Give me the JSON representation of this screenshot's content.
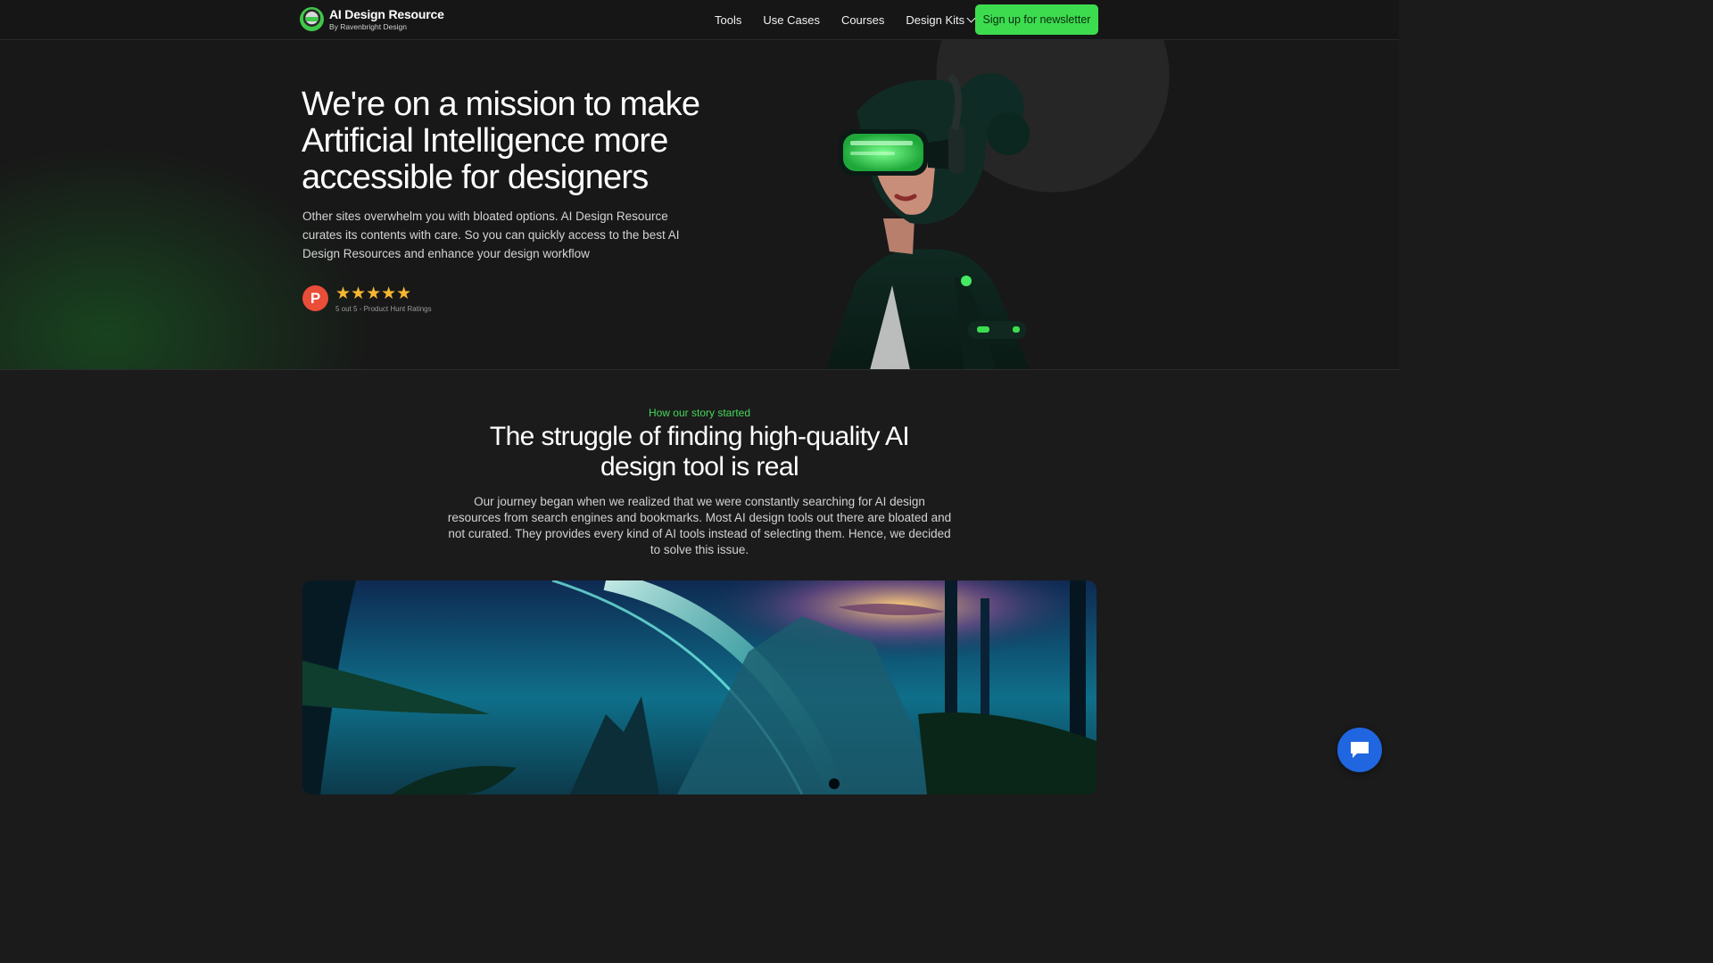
{
  "nav": {
    "logo_title": "AI Design Resource",
    "logo_sub": "By Ravenbright Design",
    "links": [
      "Tools",
      "Use Cases",
      "Courses",
      "Design Kits"
    ],
    "cta": "Sign up for newsletter"
  },
  "hero": {
    "title": "We're on a mission to make Artificial Intelligence more accessible for designers",
    "description": "Other sites overwhelm you with bloated options. AI Design Resource curates its contents with care. So you can quickly access to the best AI Design Resources and enhance your design workflow",
    "badge_letter": "P",
    "stars": "★★★★★",
    "rating_value": 5,
    "rating_max": 5,
    "rating_label": "5 out 5 - Product Hunt Ratings"
  },
  "story": {
    "eyebrow": "How our story started",
    "title": "The struggle of finding high-quality AI design tool is real",
    "description": "Our journey began when we realized that we were constantly searching for AI design resources from search engines and bookmarks. Most AI design tools out there are bloated and not curated. They provides every kind of AI tools instead of selecting them. Hence, we decided to solve this issue."
  },
  "colors": {
    "accent": "#3ddc4f",
    "background": "#1b1b1b",
    "chat": "#1f66e0",
    "producthunt": "#ea4d38",
    "star": "#f7b731"
  },
  "icons": [
    "logo-mark-icon",
    "chevron-down-icon",
    "producthunt-icon",
    "star-icon",
    "chat-icon"
  ]
}
